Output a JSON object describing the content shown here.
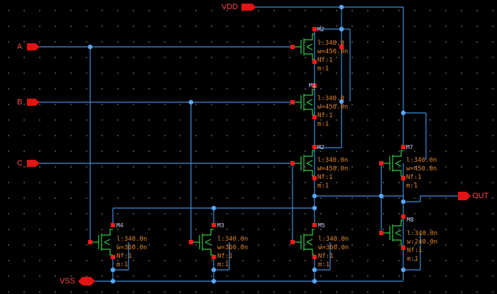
{
  "pins": {
    "vdd": "VDD",
    "vss": "VSS",
    "a": "A",
    "b": "B",
    "c": "C",
    "out": "OUT"
  },
  "transistors": [
    {
      "name": "M2",
      "l": "l:340.0",
      "w": "w=450.0n",
      "nf": "Nf:1",
      "m": "m:1"
    },
    {
      "name": "M1",
      "l": "l:340.0",
      "w": "w=450.0n",
      "nf": "Nf:1",
      "m": "m:1"
    },
    {
      "name": "M2",
      "l": "l:340.0n",
      "w": "w=450.0n",
      "nf": "Nf:1",
      "m": "m:1"
    },
    {
      "name": "M7",
      "l": "l:340.0n",
      "w": "w=450.0n",
      "nf": "Nf:1",
      "m": "m:1"
    },
    {
      "name": "M4",
      "l": "l:340.0n",
      "w": "w=360.0n",
      "nf": "Nf:1",
      "m": "m:1"
    },
    {
      "name": "M3",
      "l": "l:340.0n",
      "w": "w=360.0n",
      "nf": "Nf:1",
      "m": "m:1"
    },
    {
      "name": "M5",
      "l": "l:340.0n",
      "w": "w=360.0n",
      "nf": "Nf:1",
      "m": "m:1"
    },
    {
      "name": "M8",
      "l": "l:340.0n",
      "w": "w:240.0n",
      "nf": "Nf:1",
      "m": "m:1"
    }
  ],
  "colors": {
    "background": "#000000",
    "wire": "#3f8fdc",
    "pin": "#e11414",
    "symbol": "#2ecf4a",
    "label": "#e0862c"
  }
}
